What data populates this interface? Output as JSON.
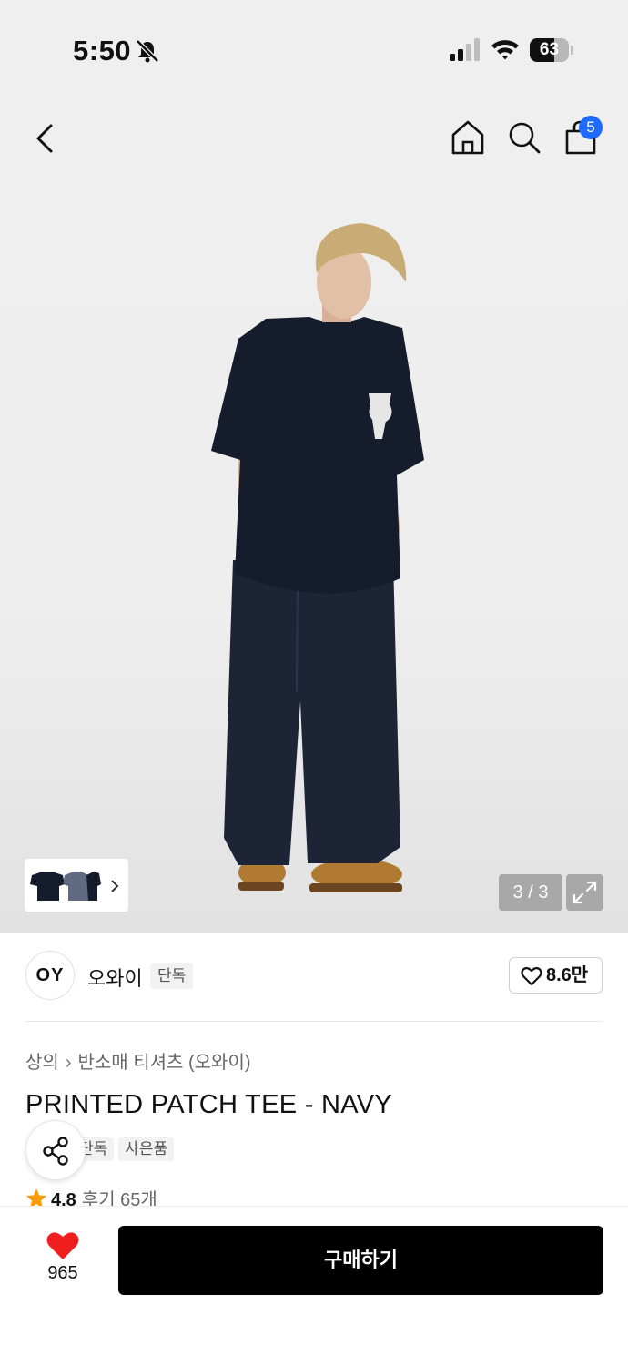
{
  "status_bar": {
    "time": "5:50",
    "battery_level": "63",
    "icons": [
      "bell-slash-icon",
      "cellular-signal-icon",
      "wifi-icon",
      "battery-icon"
    ]
  },
  "nav": {
    "icons": [
      "back-chevron-icon",
      "home-icon",
      "search-icon",
      "shopping-bag-icon"
    ],
    "cart_count": "5"
  },
  "gallery": {
    "counter": "3 / 3",
    "icons": [
      "thumbnail-strip",
      "chevron-right-icon",
      "expand-icon"
    ]
  },
  "brand": {
    "logo_text": "OY",
    "name": "오와이",
    "badge": "단독",
    "like_count": "8.6만"
  },
  "breadcrumb": {
    "category": "상의",
    "subcategory": "반소매 티셔츠 (오와이)"
  },
  "product": {
    "title": "PRINTED PATCH TEE - NAVY",
    "tags": [
      "단독",
      "사은품"
    ],
    "rating": "4.8",
    "reviews": "후기 65개"
  },
  "bottom_bar": {
    "wish_count": "965",
    "buy_label": "구매하기"
  },
  "colors": {
    "accent_badge": "#1f6bff",
    "heart": "#f01e1e",
    "star": "#ff9c00",
    "buy_button": "#000000"
  }
}
